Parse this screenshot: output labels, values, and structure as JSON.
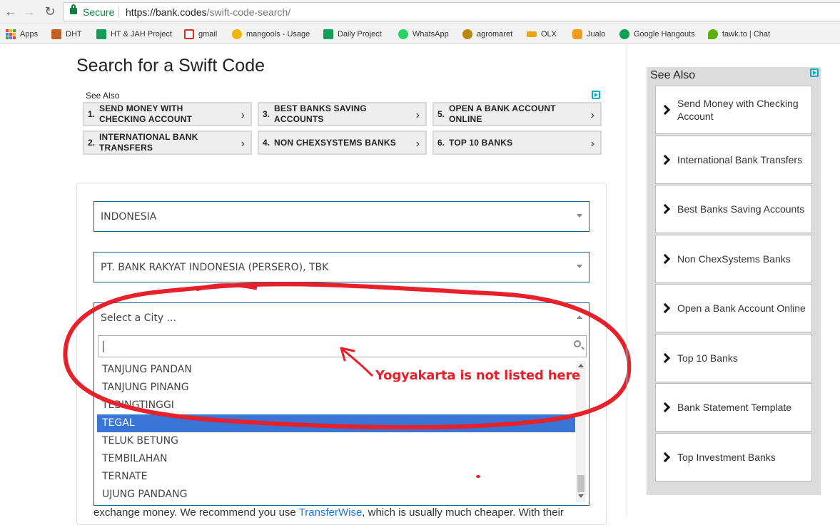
{
  "browser": {
    "secure_label": "Secure",
    "url_host": "https://bank.codes",
    "url_path": "/swift-code-search/",
    "bookmarks": [
      {
        "label": "Apps",
        "icon": "apps-grid-icon",
        "color": "#4285f4"
      },
      {
        "label": "DHT",
        "icon": "dht-icon",
        "color": "#c2601f"
      },
      {
        "label": "HT & JAH Project",
        "icon": "sheets-icon",
        "color": "#0f9d58"
      },
      {
        "label": "gmail",
        "icon": "gmail-icon",
        "color": "#d93025"
      },
      {
        "label": "mangools - Usage",
        "icon": "mangools-icon",
        "color": "#f4b400"
      },
      {
        "label": "Daily Project",
        "icon": "sheets-icon",
        "color": "#0f9d58"
      },
      {
        "label": "WhatsApp",
        "icon": "whatsapp-icon",
        "color": "#25d366"
      },
      {
        "label": "agromaret",
        "icon": "agromaret-icon",
        "color": "#b8860b"
      },
      {
        "label": "OLX",
        "icon": "olx-icon",
        "color": "#e8a317"
      },
      {
        "label": "Jualo",
        "icon": "jualo-icon",
        "color": "#f39c12"
      },
      {
        "label": "Google Hangouts",
        "icon": "hangouts-icon",
        "color": "#0f9d58"
      },
      {
        "label": "tawk.to | Chat",
        "icon": "tawk-icon",
        "color": "#59b000"
      }
    ]
  },
  "page": {
    "title": "Search for a Swift Code"
  },
  "ads": {
    "label": "See Also",
    "items": [
      {
        "num": "1.",
        "text": "SEND MONEY WITH CHECKING ACCOUNT"
      },
      {
        "num": "3.",
        "text": "BEST BANKS SAVING ACCOUNTS"
      },
      {
        "num": "5.",
        "text": "OPEN A BANK ACCOUNT ONLINE"
      },
      {
        "num": "2.",
        "text": "INTERNATIONAL BANK TRANSFERS"
      },
      {
        "num": "4.",
        "text": "NON CHEXSYSTEMS BANKS"
      },
      {
        "num": "6.",
        "text": "TOP 10 BANKS"
      }
    ]
  },
  "form": {
    "country_value": "INDONESIA",
    "bank_value": "PT. BANK RAKYAT INDONESIA (PERSERO), TBK",
    "city_placeholder": "Select a City ...",
    "city_search_value": "",
    "city_options": [
      {
        "label": "TANJUNG PANDAN",
        "highlighted": false
      },
      {
        "label": "TANJUNG PINANG",
        "highlighted": false
      },
      {
        "label": "TEBINGTINGGI",
        "highlighted": false
      },
      {
        "label": "TEGAL",
        "highlighted": true
      },
      {
        "label": "TELUK BETUNG",
        "highlighted": false
      },
      {
        "label": "TEMBILAHAN",
        "highlighted": false
      },
      {
        "label": "TERNATE",
        "highlighted": false
      },
      {
        "label": "UJUNG PANDANG",
        "highlighted": false
      }
    ]
  },
  "body": {
    "text_before": "exchange money. We recommend you use ",
    "link": "TransferWise",
    "text_after": ", which is usually much cheaper. With their"
  },
  "annotation": {
    "text": "Yogyakarta is not listed here",
    "color": "#e8202a"
  },
  "sidebar": {
    "label": "See Also",
    "items": [
      "Send Money with Checking Account",
      "International Bank Transfers",
      "Best Banks Saving Accounts",
      "Non ChexSystems Banks",
      "Open a Bank Account Online",
      "Top 10 Banks",
      "Bank Statement Template",
      "Top Investment Banks"
    ]
  }
}
